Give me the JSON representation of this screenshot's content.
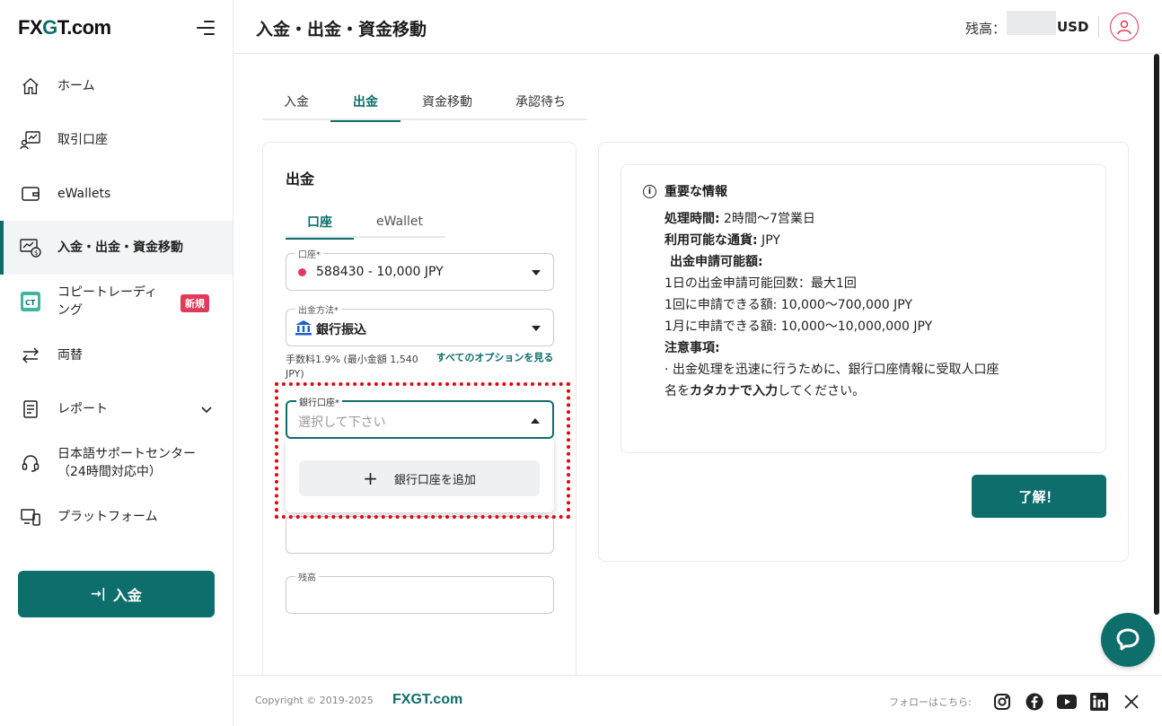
{
  "brand": {
    "logo_prefix": "FX",
    "logo_g": "G",
    "logo_suffix": "T.com"
  },
  "sidebar": {
    "items": [
      {
        "label": "ホーム",
        "icon": "home-icon"
      },
      {
        "label": "取引口座",
        "icon": "trading-account-icon"
      },
      {
        "label": "eWallets",
        "icon": "wallet-icon"
      },
      {
        "label": "入金・出金・資金移動",
        "icon": "funds-transfer-icon"
      },
      {
        "label": "コピートレーディ\nング",
        "icon": "copy-trading-icon",
        "badge": "新規",
        "logo_text": "CT"
      },
      {
        "label": "両替",
        "icon": "exchange-icon"
      },
      {
        "label": "レポート",
        "icon": "report-icon"
      },
      {
        "label": "日本語サポートセンター\n（24時間対応中）",
        "icon": "support-headset-icon"
      },
      {
        "label": "プラットフォーム",
        "icon": "platform-icon"
      }
    ],
    "deposit_button": "入金"
  },
  "header": {
    "title": "入金・出金・資金移動",
    "balance_label": "残高：",
    "currency": "USD"
  },
  "tabs": [
    "入金",
    "出金",
    "資金移動",
    "承認待ち"
  ],
  "withdraw_form": {
    "title": "出金",
    "subtabs": [
      "口座",
      "eWallet"
    ],
    "account": {
      "label": "口座*",
      "value": "588430 - 10,000 JPY"
    },
    "method": {
      "label": "出金方法*",
      "value": "銀行振込"
    },
    "fee_text": "手数料1.9% (最小金額 1,540 JPY)",
    "all_options_link": "すべてのオプションを見る",
    "bank_account": {
      "label": "銀行口座*",
      "placeholder": "選択して下さい"
    },
    "add_bank_button": "銀行口座を追加",
    "balance_field": {
      "label": "残高"
    }
  },
  "info": {
    "title": "重要な情報",
    "processing_label": "処理時間:",
    "processing_value": " 2時間〜7営業日",
    "currency_label": "利用可能な通貨:",
    "currency_value": " JPY",
    "limits_title": "出金申請可能額:",
    "limit1": "1日の出金申請可能回数：最大1回",
    "limit2": "1回に申請できる額: 10,000〜700,000 JPY",
    "limit3": "1月に申請できる額: 10,000〜10,000,000 JPY",
    "notes_title": "注意事項:",
    "note_part1": "· 出金処理を迅速に行うために、銀行口座情報に受取人口座",
    "note_part2": "名を",
    "note_bold": "カタカナで入力",
    "note_part3": "してください。",
    "ok_button": "了解！"
  },
  "footer": {
    "copyright": "Copyright © 2019-2025",
    "brand": "FXGT.com",
    "follow": "フォローはこちら:",
    "socials": [
      "instagram-icon",
      "facebook-icon",
      "youtube-icon",
      "linkedin-icon",
      "x-icon"
    ]
  },
  "colors": {
    "accent": "#0e6e6b",
    "badge": "#e0395a",
    "highlight": "#e60012"
  }
}
